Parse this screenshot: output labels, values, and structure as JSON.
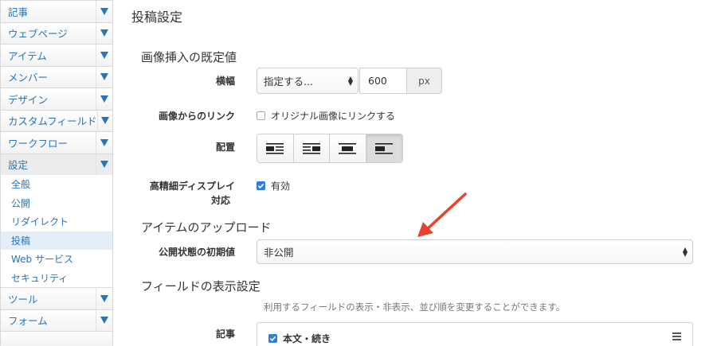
{
  "sidebar": {
    "items_top": [
      {
        "label": "記事"
      },
      {
        "label": "ウェブページ"
      },
      {
        "label": "アイテム"
      },
      {
        "label": "メンバー"
      },
      {
        "label": "デザイン"
      },
      {
        "label": "カスタムフィールド"
      },
      {
        "label": "ワークフロー"
      },
      {
        "label": "設定"
      }
    ],
    "submenu": [
      {
        "label": "全般"
      },
      {
        "label": "公開"
      },
      {
        "label": "リダイレクト"
      },
      {
        "label": "投稿"
      },
      {
        "label": "Web サービス"
      },
      {
        "label": "セキュリティ"
      }
    ],
    "items_bottom": [
      {
        "label": "ツール"
      },
      {
        "label": "フォーム"
      }
    ]
  },
  "main": {
    "page_title": "投稿設定",
    "image_section": {
      "title": "画像挿入の既定値",
      "width_label": "横幅",
      "width_select": "指定する...",
      "width_value": "600",
      "width_unit": "px",
      "link_label": "画像からのリンク",
      "link_checkbox": "オリジナル画像にリンクする",
      "align_label": "配置",
      "retina_label_1": "高精細ディスプレイ",
      "retina_label_2": "対応",
      "retina_checkbox": "有効"
    },
    "upload_section": {
      "title": "アイテムのアップロード",
      "status_label": "公開状態の初期値",
      "status_value": "非公開"
    },
    "fields_section": {
      "title": "フィールドの表示設定",
      "help": "利用するフィールドの表示・非表示、並び順を変更することができます。",
      "entry_label": "記事",
      "entry_field": "本文・続き"
    }
  },
  "colors": {
    "link": "#2b74b8",
    "checkbox": "#2f7fd6",
    "annotation_arrow": "#e8412c"
  }
}
